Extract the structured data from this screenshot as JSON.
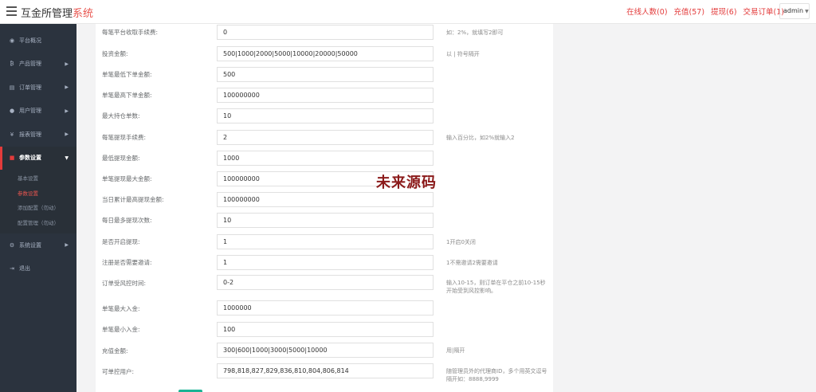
{
  "header": {
    "brand_main": "互金所管理",
    "brand_accent": "系统",
    "links": [
      "在线人数(0)",
      "充值(57)",
      "提现(6)",
      "交易订单(1)"
    ],
    "admin": "admin"
  },
  "sidebar": {
    "items": [
      {
        "label": "平台概况",
        "icon": "dashboard-icon",
        "glyph": "◉"
      },
      {
        "label": "产品管理",
        "icon": "bitcoin-icon",
        "glyph": "₿"
      },
      {
        "label": "订单管理",
        "icon": "orders-icon",
        "glyph": "▤"
      },
      {
        "label": "用户管理",
        "icon": "user-icon",
        "glyph": "●"
      },
      {
        "label": "报表管理",
        "icon": "yen-icon",
        "glyph": "¥"
      },
      {
        "label": "参数设置",
        "icon": "settings-book-icon",
        "glyph": "■"
      },
      {
        "label": "系统设置",
        "icon": "gears-icon",
        "glyph": "⚙"
      },
      {
        "label": "退出",
        "icon": "logout-icon",
        "glyph": "⇥"
      }
    ],
    "sub_items": [
      "基本设置",
      "参数设置",
      "添加配置（勿动）",
      "配置管理（勿动）"
    ]
  },
  "form": {
    "rows": [
      {
        "label": "每笔平台收取手续费:",
        "value": "0",
        "hint": "如：2%，就填写2即可"
      },
      {
        "label": "投资金额:",
        "value": "500|1000|2000|5000|10000|20000|50000",
        "hint": "以 | 符号隔开"
      },
      {
        "label": "单笔最低下单金额:",
        "value": "500",
        "hint": ""
      },
      {
        "label": "单笔最高下单金额:",
        "value": "100000000",
        "hint": ""
      },
      {
        "label": "最大持仓单数:",
        "value": "10",
        "hint": ""
      },
      {
        "label": "每笔提现手续费:",
        "value": "2",
        "hint": "输入百分比，如2%就输入2"
      },
      {
        "label": "最低提现金额:",
        "value": "1000",
        "hint": ""
      },
      {
        "label": "单笔提现最大金额:",
        "value": "100000000",
        "hint": ""
      },
      {
        "label": "当日累计最高提现金额:",
        "value": "100000000",
        "hint": ""
      },
      {
        "label": "每日最多提现次数:",
        "value": "10",
        "hint": ""
      },
      {
        "label": "是否开启提现:",
        "value": "1",
        "hint": "1开启0关闭"
      },
      {
        "label": "注册是否需要邀请:",
        "value": "1",
        "hint": "1不需邀请2需要邀请"
      },
      {
        "label": "订单受风控时间:",
        "value": "0-2",
        "hint": "输入10-15，则订单在平仓之前10-15秒开始受到风控影响。"
      },
      {
        "label": "单笔最大入金:",
        "value": "1000000",
        "hint": ""
      },
      {
        "label": "单笔最小入金:",
        "value": "100",
        "hint": ""
      },
      {
        "label": "充值金额:",
        "value": "300|600|1000|3000|5000|10000",
        "hint": "用|隔开"
      },
      {
        "label": "可单控用户:",
        "value": "798,818,827,829,836,810,804,806,814",
        "hint": "随管理员外的代理商ID，多个用英文逗号隔开如：8888,9999"
      }
    ]
  },
  "watermark": "未来源码"
}
